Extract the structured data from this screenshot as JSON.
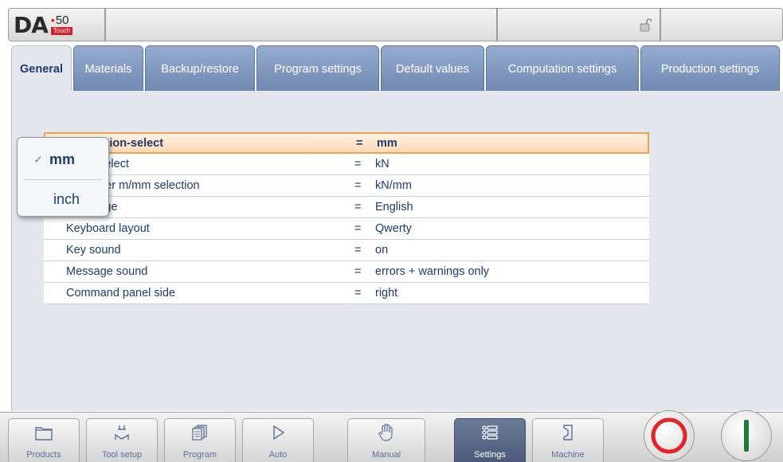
{
  "header": {
    "logo_text": "DA",
    "model_number": "50",
    "model_badge": "Touch"
  },
  "tabs": [
    {
      "label": "General",
      "active": true
    },
    {
      "label": "Materials",
      "active": false
    },
    {
      "label": "Backup/restore",
      "active": false
    },
    {
      "label": "Program settings",
      "active": false
    },
    {
      "label": "Default values",
      "active": false
    },
    {
      "label": "Computation settings",
      "active": false
    },
    {
      "label": "Production settings",
      "active": false
    }
  ],
  "settings": [
    {
      "label": "Dimension-select",
      "value": "mm",
      "selected": true
    },
    {
      "label": "Force select",
      "value": "kN",
      "selected": false
    },
    {
      "label": "Force per m/mm selection",
      "value": "kN/mm",
      "selected": false
    },
    {
      "label": "Language",
      "value": "English",
      "selected": false
    },
    {
      "label": "Keyboard layout",
      "value": "Qwerty",
      "selected": false
    },
    {
      "label": "Key sound",
      "value": "on",
      "selected": false
    },
    {
      "label": "Message sound",
      "value": "errors + warnings only",
      "selected": false
    },
    {
      "label": "Command panel side",
      "value": "right",
      "selected": false
    }
  ],
  "equals_sign": "=",
  "popup": {
    "check_mark": "✓",
    "options": [
      {
        "label": "mm",
        "checked": true
      },
      {
        "label": "inch",
        "checked": false
      }
    ]
  },
  "nav": [
    {
      "label": "Products",
      "icon": "folder-icon",
      "active": false
    },
    {
      "label": "Tool setup",
      "icon": "tool-setup-icon",
      "active": false
    },
    {
      "label": "Program",
      "icon": "program-pages-icon",
      "active": false
    },
    {
      "label": "Auto",
      "icon": "play-icon",
      "active": false
    },
    {
      "label": "Manual",
      "icon": "hand-icon",
      "active": false
    },
    {
      "label": "Settings",
      "icon": "settings-list-icon",
      "active": true
    },
    {
      "label": "Machine",
      "icon": "machine-icon",
      "active": false
    }
  ],
  "controls": {
    "stop_color": "#e3242b",
    "start_color": "#1e7a3a"
  },
  "colors": {
    "tab_blue": "#7c93bd",
    "text_blue": "#1d3a6e",
    "selected_border": "#f0a050",
    "nav_active": "#5a6a88"
  }
}
